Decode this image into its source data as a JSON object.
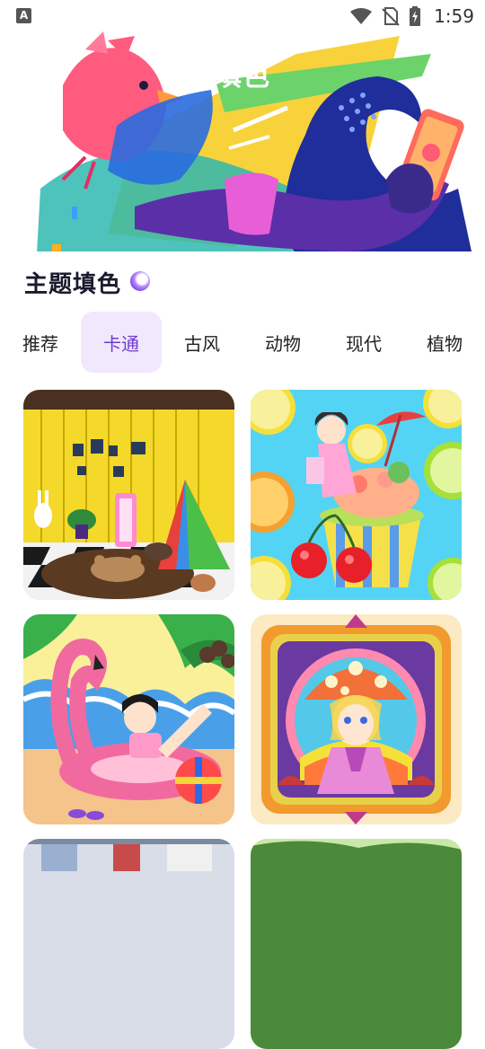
{
  "status_bar": {
    "app_badge": "A",
    "time": "1:59",
    "icons": [
      "wifi-icon",
      "no-sim-icon",
      "battery-charging-icon"
    ]
  },
  "hero": {
    "title": "填色",
    "illustration": "bird-and-figure-with-phone-illustration"
  },
  "section": {
    "title": "主题填色",
    "accent_icon": "purple-orb-icon"
  },
  "tabs": [
    {
      "label": "推荐",
      "active": false
    },
    {
      "label": "卡通",
      "active": true
    },
    {
      "label": "古风",
      "active": false
    },
    {
      "label": "动物",
      "active": false
    },
    {
      "label": "现代",
      "active": false
    },
    {
      "label": "植物",
      "active": false
    }
  ],
  "colors": {
    "accent": "#6f3ccf",
    "tab_active_bg": "#f1e8fd"
  },
  "gallery": [
    {
      "id": "cartoon-room",
      "subject": "yellow room with teddy bear rug"
    },
    {
      "id": "girl-on-dessert",
      "subject": "girl sitting on fruit dessert with lemons"
    },
    {
      "id": "flamingo-float",
      "subject": "girl on flamingo float at beach"
    },
    {
      "id": "mushroom-girl",
      "subject": "mushroom hat girl in ornate frame"
    },
    {
      "id": "city-street",
      "subject": "partially visible street scene"
    },
    {
      "id": "green-hills",
      "subject": "partially visible green hills"
    }
  ]
}
